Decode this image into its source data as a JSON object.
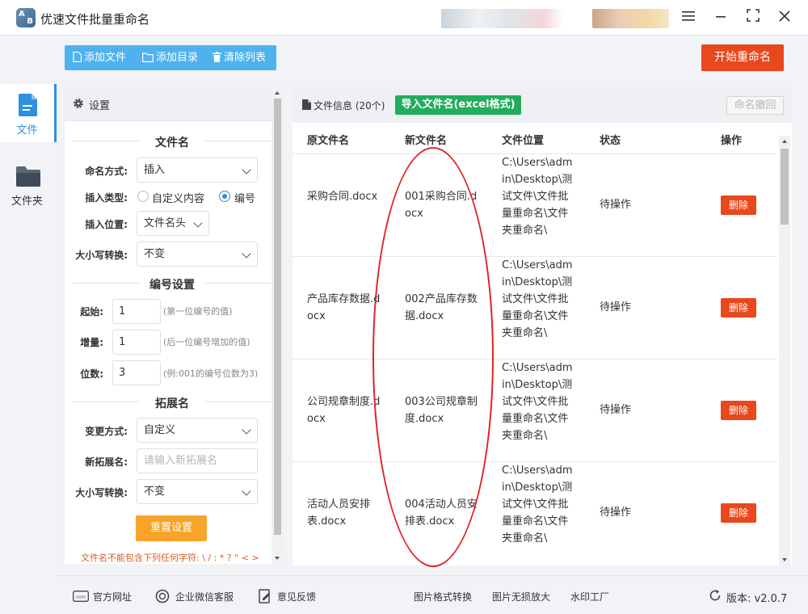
{
  "window": {
    "title": "优速文件批量重命名",
    "logo_letters": [
      "A",
      "B"
    ]
  },
  "nav": [
    {
      "label": "文件",
      "icon": "file-icon",
      "active": true
    },
    {
      "label": "文件夹",
      "icon": "folder-icon",
      "active": false
    }
  ],
  "toolbar": {
    "add_file": "添加文件",
    "add_dir": "添加目录",
    "clear_list": "清除列表",
    "start": "开始重命名"
  },
  "settings": {
    "title": "设置",
    "filename_section": "文件名",
    "naming_mode_label": "命名方式:",
    "naming_mode_value": "插入",
    "insert_type_label": "插入类型:",
    "insert_type_options": [
      "自定义内容",
      "编号"
    ],
    "insert_type_selected": "编号",
    "insert_pos_label": "插入位置:",
    "insert_pos_value": "文件名头",
    "case_label": "大小写转换:",
    "case_value": "不变",
    "number_section": "编号设置",
    "start_label": "起始:",
    "start_value": "1",
    "start_hint": "(第一位编号的值)",
    "step_label": "增量:",
    "step_value": "1",
    "step_hint": "(后一位编号增加的值)",
    "digits_label": "位数:",
    "digits_value": "3",
    "digits_hint": "(例:001的编号位数为3)",
    "ext_section": "拓展名",
    "ext_mode_label": "变更方式:",
    "ext_mode_value": "自定义",
    "new_ext_label": "新拓展名:",
    "new_ext_placeholder": "请输入新拓展名",
    "ext_case_label": "大小写转换:",
    "ext_case_value": "不变",
    "reset": "重置设置",
    "warning": "文件名不能包含下列任何字符: \\ / : * ? \" < >"
  },
  "files": {
    "title": "文件信息 (20个)",
    "import_btn": "导入文件名(excel格式)",
    "undo_btn": "命名撤回",
    "columns": [
      "原文件名",
      "新文件名",
      "文件位置",
      "状态",
      "操作"
    ],
    "rows": [
      {
        "orig": "采购合同.docx",
        "new": "001采购合同.docx",
        "location": "C:\\Users\\admin\\Desktop\\测试文件\\文件批量重命名\\文件夹重命名\\",
        "status": "待操作",
        "action": "删除"
      },
      {
        "orig": "产品库存数据.docx",
        "new": "002产品库存数据.docx",
        "location": "C:\\Users\\admin\\Desktop\\测试文件\\文件批量重命名\\文件夹重命名\\",
        "status": "待操作",
        "action": "删除"
      },
      {
        "orig": "公司规章制度.docx",
        "new": "003公司规章制度.docx",
        "location": "C:\\Users\\admin\\Desktop\\测试文件\\文件批量重命名\\文件夹重命名\\",
        "status": "待操作",
        "action": "删除"
      },
      {
        "orig": "活动人员安排表.docx",
        "new": "004活动人员安排表.docx",
        "location": "C:\\Users\\admin\\Desktop\\测试文件\\文件批量重命名\\文件夹重命名\\",
        "status": "待操作",
        "action": "删除"
      }
    ]
  },
  "footer": {
    "website": "官方网址",
    "wechat": "企业微信客服",
    "feedback": "意见反馈",
    "img_convert": "图片格式转换",
    "img_enlarge": "图片无损放大",
    "watermark": "水印工厂",
    "version": "版本: v2.0.7"
  },
  "colors": {
    "accent_blue": "#4fb2ef",
    "start_red": "#e8481c",
    "import_green": "#22ad5c",
    "reset_orange": "#f8a42a",
    "highlight_ellipse": "#e02424"
  }
}
